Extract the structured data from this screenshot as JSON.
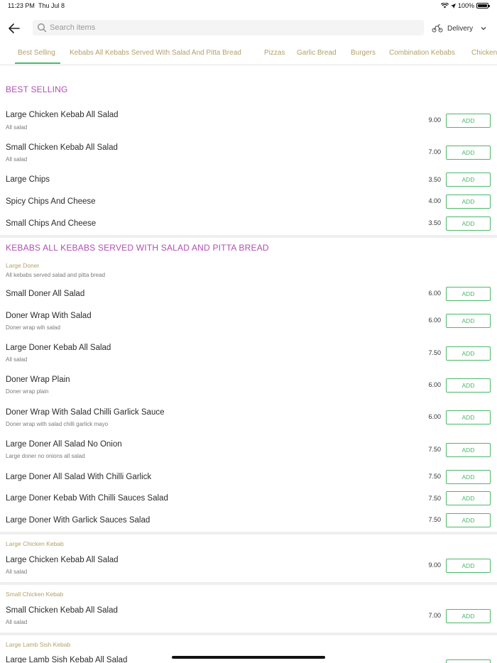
{
  "status_bar": {
    "time": "11:23 PM",
    "date": "Thu Jul 8",
    "battery": "100%",
    "icons": [
      "wifi-icon",
      "location-icon",
      "battery-icon"
    ]
  },
  "header": {
    "back_icon": "arrow-left-icon",
    "search_placeholder": "Search items",
    "delivery_label": "Delivery"
  },
  "tabs": [
    {
      "label": "Best Selling",
      "active": true
    },
    {
      "label": "Kebabs All Kebabs Served With Salad And Pitta Bread"
    },
    {
      "label": "Pizzas"
    },
    {
      "label": "Garlic Bread"
    },
    {
      "label": "Burgers"
    },
    {
      "label": "Combination Kebabs"
    },
    {
      "label": "Chicken"
    }
  ],
  "colors": {
    "accent": "#4cb86a",
    "section_title": "#b04fb4",
    "tab_text": "#b3a06a"
  },
  "add_label": "ADD",
  "best_selling": {
    "title": "BEST SELLING",
    "items": [
      {
        "name": "Large Chicken Kebab All Salad",
        "desc": "All salad",
        "price": "9.00"
      },
      {
        "name": "Small Chicken Kebab All Salad",
        "desc": "All salad",
        "price": "7.00"
      },
      {
        "name": "Large Chips",
        "price": "3.50"
      },
      {
        "name": "Spicy Chips And Cheese",
        "price": "4.00"
      },
      {
        "name": "Small Chips And Cheese",
        "price": "3.50"
      }
    ]
  },
  "kebabs": {
    "title": "KEBABS ALL KEBABS SERVED WITH SALAD AND PITTA BREAD",
    "large_doner": {
      "heading": "Large Doner",
      "desc": "All kebabs served salad and pitta bread",
      "items": [
        {
          "name": "Small Doner All Salad",
          "price": "6.00"
        },
        {
          "name": "Doner Wrap With Salad",
          "desc": "Doner wrap wih salad",
          "price": "6.00"
        },
        {
          "name": "Large Doner Kebab All Salad",
          "desc": "All salad",
          "price": "7.50"
        },
        {
          "name": "Doner Wrap Plain",
          "desc": "Doner wrap plain",
          "price": "6.00"
        },
        {
          "name": "Doner Wrap With Salad Chilli Garlick Sauce",
          "desc": "Doner wrap with salad chilli garlick mayo",
          "price": "6.00"
        },
        {
          "name": "Large Doner All Salad No Onion",
          "desc": "Large doner no onions all salad",
          "price": "7.50"
        },
        {
          "name": "Large Doner All Salad With Chilli Garlick",
          "price": "7.50"
        },
        {
          "name": "Large Doner Kebab With Chilli Sauces Salad",
          "price": "7.50"
        },
        {
          "name": "Large Doner With Garlick Sauces Salad",
          "price": "7.50"
        }
      ]
    },
    "large_chicken": {
      "heading": "Large Chicken Kebab",
      "items": [
        {
          "name": "Large Chicken Kebab All Salad",
          "desc": "All salad",
          "price": "9.00"
        }
      ]
    },
    "small_chicken": {
      "heading": "Small Chicken Kebab",
      "items": [
        {
          "name": "Small Chicken Kebab All Salad",
          "desc": "All salad",
          "price": "7.00"
        }
      ]
    },
    "lamb_sish": {
      "heading": "Large Lamb Sish Kebab",
      "items": [
        {
          "name": "Large Lamb Sish Kebab All Salad"
        }
      ]
    }
  }
}
